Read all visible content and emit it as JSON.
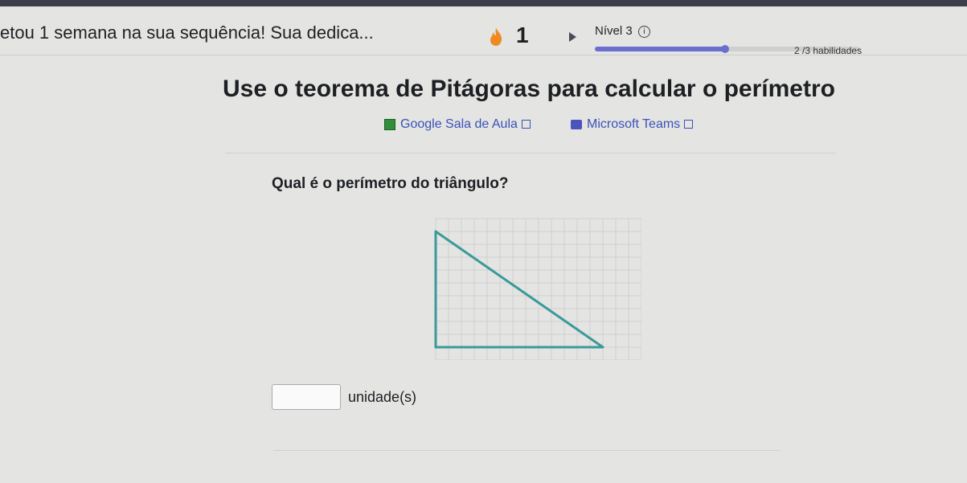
{
  "header": {
    "streak_message": "etou 1 semana na sua sequência! Sua dedica...",
    "streak_count": "1",
    "level_label": "Nível 3",
    "level_info_glyph": "i",
    "progress_fraction": 0.49,
    "skills_text": "2 /3 habilidades",
    "accent_color": "#6a6fcf"
  },
  "main": {
    "title": "Use o teorema de Pitágoras para calcular o perímetro",
    "share_links": [
      {
        "label": "Google Sala de Aula",
        "icon": "google-classroom-icon"
      },
      {
        "label": "Microsoft Teams",
        "icon": "microsoft-teams-icon"
      }
    ],
    "question": "Qual é o perímetro do triângulo?",
    "answer": {
      "value": "",
      "unit": "unidade(s)"
    }
  },
  "triangle": {
    "grid_columns": 16,
    "grid_rows": 11,
    "vertices": [
      [
        0,
        1
      ],
      [
        0,
        10
      ],
      [
        13,
        10
      ]
    ],
    "stroke_color": "#3a9a9a"
  }
}
